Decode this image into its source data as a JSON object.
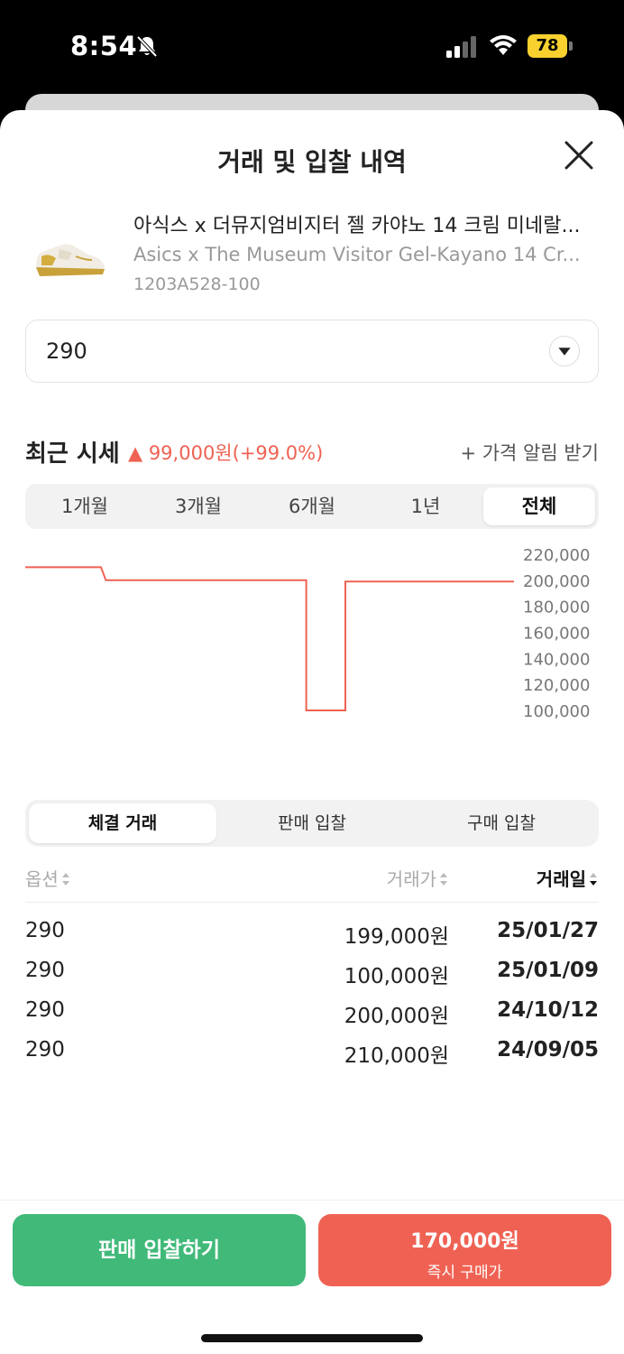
{
  "status_bar": {
    "time": "8:54",
    "battery": "78"
  },
  "sheet": {
    "title": "거래 및 입찰 내역"
  },
  "product": {
    "name_ko": "아식스 x 더뮤지엄비지터 젤 카야노 14 크림 미네랄...",
    "name_en": "Asics x The Museum Visitor Gel-Kayano 14 Cr...",
    "code": "1203A528-100"
  },
  "size_select": {
    "value": "290"
  },
  "recent": {
    "title": "최근 시세",
    "change": "▲ 99,000원(+99.0%)",
    "alert_link": "+ 가격 알림 받기"
  },
  "range_tabs": [
    {
      "label": "1개월",
      "active": false
    },
    {
      "label": "3개월",
      "active": false
    },
    {
      "label": "6개월",
      "active": false
    },
    {
      "label": "1년",
      "active": false
    },
    {
      "label": "전체",
      "active": true
    }
  ],
  "colors": {
    "line": "#ef6253",
    "sell": "#41b979",
    "buy": "#ef6253"
  },
  "chart_data": {
    "type": "line",
    "y_ticks": [
      "220,000",
      "200,000",
      "180,000",
      "160,000",
      "140,000",
      "120,000",
      "100,000"
    ],
    "ylim": [
      100000,
      220000
    ],
    "series": [
      {
        "values": [
          {
            "x": 0,
            "y": 210000
          },
          {
            "x": 0.155,
            "y": 210000
          },
          {
            "x": 0.165,
            "y": 200000
          },
          {
            "x": 0.575,
            "y": 200000
          },
          {
            "x": 0.575,
            "y": 100000
          },
          {
            "x": 0.655,
            "y": 100000
          },
          {
            "x": 0.655,
            "y": 199000
          },
          {
            "x": 1,
            "y": 199000
          }
        ]
      }
    ]
  },
  "deal_tabs": [
    {
      "label": "체결 거래",
      "active": true
    },
    {
      "label": "판매 입찰",
      "active": false
    },
    {
      "label": "구매 입찰",
      "active": false
    }
  ],
  "table": {
    "headers": {
      "size": "옵션",
      "price": "거래가",
      "date": "거래일"
    },
    "rows": [
      {
        "size": "290",
        "price": "199,000원",
        "date": "25/01/27"
      },
      {
        "size": "290",
        "price": "100,000원",
        "date": "25/01/09"
      },
      {
        "size": "290",
        "price": "200,000원",
        "date": "24/10/12"
      },
      {
        "size": "290",
        "price": "210,000원",
        "date": "24/09/05"
      }
    ]
  },
  "actions": {
    "sell_label": "판매 입찰하기",
    "buy_price": "170,000원",
    "buy_label": "즉시 구매가"
  }
}
